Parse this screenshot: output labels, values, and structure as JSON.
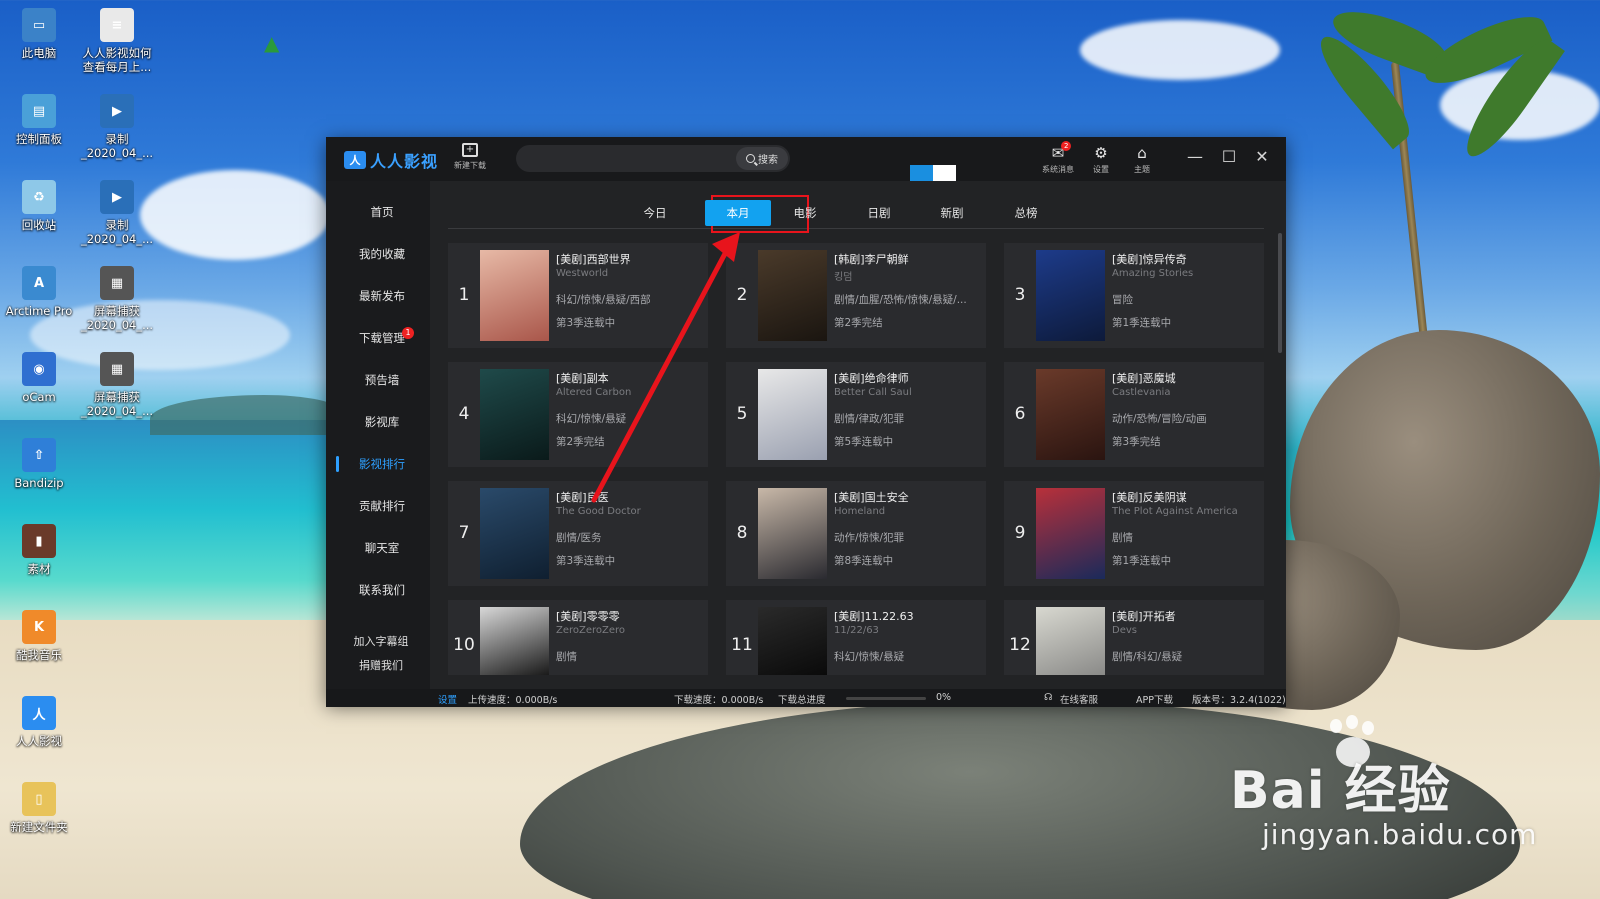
{
  "desktop": {
    "icons": [
      {
        "label": "此电脑",
        "color": "#3b82c8",
        "glyph": "▭"
      },
      {
        "label": "人人影视如何查看每月上...",
        "color": "#e9e9e9",
        "glyph": "≡"
      },
      {
        "label": "控制面板",
        "color": "#4aa0d8",
        "glyph": "▤"
      },
      {
        "label": "录制_2020_04_...",
        "color": "#2a6fb8",
        "glyph": "▶"
      },
      {
        "label": "回收站",
        "color": "#8ec8e8",
        "glyph": "♻"
      },
      {
        "label": "录制_2020_04_...",
        "color": "#2a6fb8",
        "glyph": "▶"
      },
      {
        "label": "Arctime Pro",
        "color": "#3a8ad0",
        "glyph": "A"
      },
      {
        "label": "屏幕捕获_2020_04_...",
        "color": "#555",
        "glyph": "▦"
      },
      {
        "label": "oCam",
        "color": "#2f6fd0",
        "glyph": "◉"
      },
      {
        "label": "屏幕捕获_2020_04_...",
        "color": "#555",
        "glyph": "▦"
      },
      {
        "label": "Bandizip",
        "color": "#2f7fd8",
        "glyph": "⇧"
      },
      {
        "label": "素材",
        "color": "#6a3a2a",
        "glyph": "▮"
      },
      {
        "label": "酷我音乐",
        "color": "#f08a2a",
        "glyph": "K"
      },
      {
        "label": "人人影视",
        "color": "#2b8df0",
        "glyph": "人"
      },
      {
        "label": "新建文件夹",
        "color": "#e8c35a",
        "glyph": "▯"
      }
    ]
  },
  "watermark": {
    "brand": "Bai 经验",
    "url": "jingyan.baidu.com"
  },
  "app": {
    "logo_text": "人人影视",
    "logo_mark": "人",
    "new_download_label": "新建下载",
    "search_placeholder": "",
    "search_button": "搜索",
    "toolbar": {
      "messages_label": "系统消息",
      "messages_badge": "2",
      "settings_label": "设置",
      "theme_label": "主题"
    },
    "sidebar": {
      "items": [
        {
          "label": "首页"
        },
        {
          "label": "我的收藏"
        },
        {
          "label": "最新发布"
        },
        {
          "label": "下载管理",
          "badge": "1"
        },
        {
          "label": "预告墙"
        },
        {
          "label": "影视库"
        },
        {
          "label": "影视排行"
        },
        {
          "label": "贡献排行"
        },
        {
          "label": "聊天室"
        },
        {
          "label": "联系我们"
        }
      ],
      "active_index": 6,
      "footer": [
        "加入字幕组",
        "捐赠我们"
      ]
    },
    "tabs": [
      {
        "label": "今日"
      },
      {
        "label": "本月"
      },
      {
        "label": "电影"
      },
      {
        "label": "日剧"
      },
      {
        "label": "新剧"
      },
      {
        "label": "总榜"
      }
    ],
    "active_tab": 1,
    "rankings": [
      {
        "rank": "1",
        "title": "[美剧]西部世界",
        "subtitle": "Westworld",
        "genre": "科幻/惊悚/悬疑/西部",
        "status": "第3季连载中",
        "colors": [
          "#e7b9a6",
          "#a9564a"
        ]
      },
      {
        "rank": "2",
        "title": "[韩剧]李尸朝鲜",
        "subtitle": "킹덤",
        "genre": "剧情/血腥/恐怖/惊悚/悬疑/...",
        "status": "第2季完结",
        "colors": [
          "#4a3a2a",
          "#1a1510"
        ]
      },
      {
        "rank": "3",
        "title": "[美剧]惊异传奇",
        "subtitle": "Amazing Stories",
        "genre": "冒险",
        "status": "第1季连载中",
        "colors": [
          "#1d3b8a",
          "#0d1a3a"
        ]
      },
      {
        "rank": "4",
        "title": "[美剧]副本",
        "subtitle": "Altered Carbon",
        "genre": "科幻/惊悚/悬疑",
        "status": "第2季完结",
        "colors": [
          "#1f4a4a",
          "#0a1a1a"
        ]
      },
      {
        "rank": "5",
        "title": "[美剧]绝命律师",
        "subtitle": "Better Call Saul",
        "genre": "剧情/律政/犯罪",
        "status": "第5季连载中",
        "colors": [
          "#e8e8e8",
          "#9aa0b0"
        ]
      },
      {
        "rank": "6",
        "title": "[美剧]恶魔城",
        "subtitle": "Castlevania",
        "genre": "动作/恐怖/冒险/动画",
        "status": "第3季完结",
        "colors": [
          "#6a3a2a",
          "#2a1410"
        ]
      },
      {
        "rank": "7",
        "title": "[美剧]良医",
        "subtitle": "The Good Doctor",
        "genre": "剧情/医务",
        "status": "第3季连载中",
        "colors": [
          "#2a4a6a",
          "#0f1f30"
        ]
      },
      {
        "rank": "8",
        "title": "[美剧]国土安全",
        "subtitle": "Homeland",
        "genre": "动作/惊悚/犯罪",
        "status": "第8季连载中",
        "colors": [
          "#c8b8a8",
          "#2a2a30"
        ]
      },
      {
        "rank": "9",
        "title": "[美剧]反美阴谋",
        "subtitle": "The Plot Against America",
        "genre": "剧情",
        "status": "第1季连载中",
        "colors": [
          "#b8303a",
          "#1a2a5a"
        ]
      },
      {
        "rank": "10",
        "title": "[美剧]零零零",
        "subtitle": "ZeroZeroZero",
        "genre": "剧情",
        "status": "",
        "colors": [
          "#d8d8d8",
          "#1a1a1a"
        ]
      },
      {
        "rank": "11",
        "title": "[美剧]11.22.63",
        "subtitle": "11/22/63",
        "genre": "科幻/惊悚/悬疑",
        "status": "",
        "colors": [
          "#2a2a2a",
          "#0a0a0a"
        ]
      },
      {
        "rank": "12",
        "title": "[美剧]开拓者",
        "subtitle": "Devs",
        "genre": "剧情/科幻/悬疑",
        "status": "",
        "colors": [
          "#d8d8d0",
          "#8a8a88"
        ]
      }
    ],
    "statusbar": {
      "settings": "设置",
      "upload": "上传速度：0.000B/s",
      "download": "下载速度：0.000B/s",
      "progress_label": "下载总进度",
      "progress_value": "0%",
      "progress_fraction": 0,
      "service": "在线客服",
      "app_download": "APP下载",
      "version": "版本号：3.2.4(1022)"
    }
  },
  "colors": {
    "accent": "#12a2f0",
    "highlight": "#e8141c",
    "window_bg": "#1f2022"
  }
}
